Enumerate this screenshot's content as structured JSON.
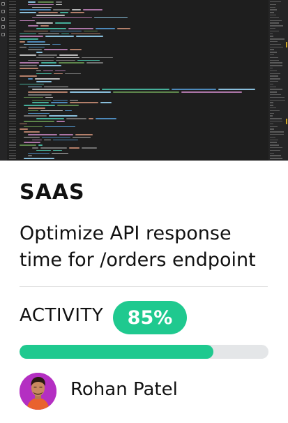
{
  "card": {
    "category": "SAAS",
    "title": "Optimize API response time for /orders endpoint",
    "activity": {
      "label": "ACTIVITY",
      "percent_text": "85%",
      "progress_fraction": 0.78
    },
    "assignee": {
      "name": "Rohan Patel"
    }
  },
  "preview": {
    "theme": "dark code editor",
    "background_color": "#1e1e1e"
  },
  "colors": {
    "accent": "#1fc98f",
    "track": "#e4e6e8",
    "avatar_bg": "#b42fc2"
  },
  "icons": [
    "files-icon",
    "search-icon",
    "source-control-icon",
    "run-debug-icon",
    "extensions-icon"
  ]
}
